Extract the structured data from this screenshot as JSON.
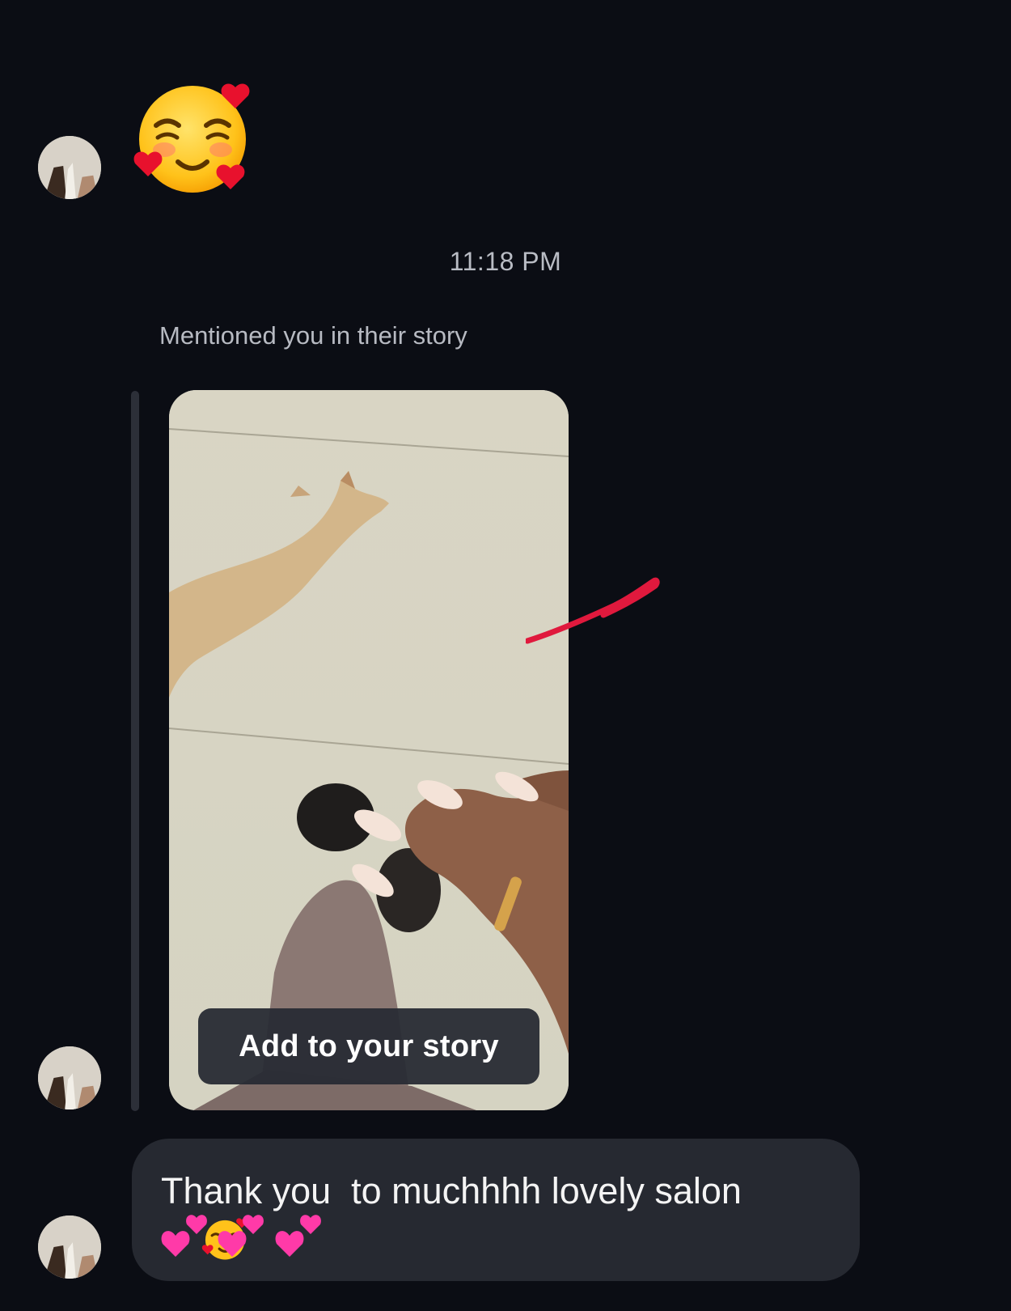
{
  "thread": {
    "timestamp": "11:18 PM",
    "story_mention_label": "Mentioned you in their story",
    "story_card": {
      "button_label": "Add to your story"
    },
    "message": {
      "text": "Thank you  to muchhhh lovely salon"
    }
  },
  "icons": {
    "big_emoji": "smiling-face-with-hearts-icon",
    "inline_emoji": "smiling-face-with-hearts-icon",
    "hearts": [
      "two-hearts-icon",
      "two-hearts-icon",
      "two-hearts-icon"
    ]
  },
  "colors": {
    "background": "#0b0d14",
    "bubble": "#262931",
    "annotation": "#e0193d",
    "heart_pink": "#ff3aa8"
  }
}
